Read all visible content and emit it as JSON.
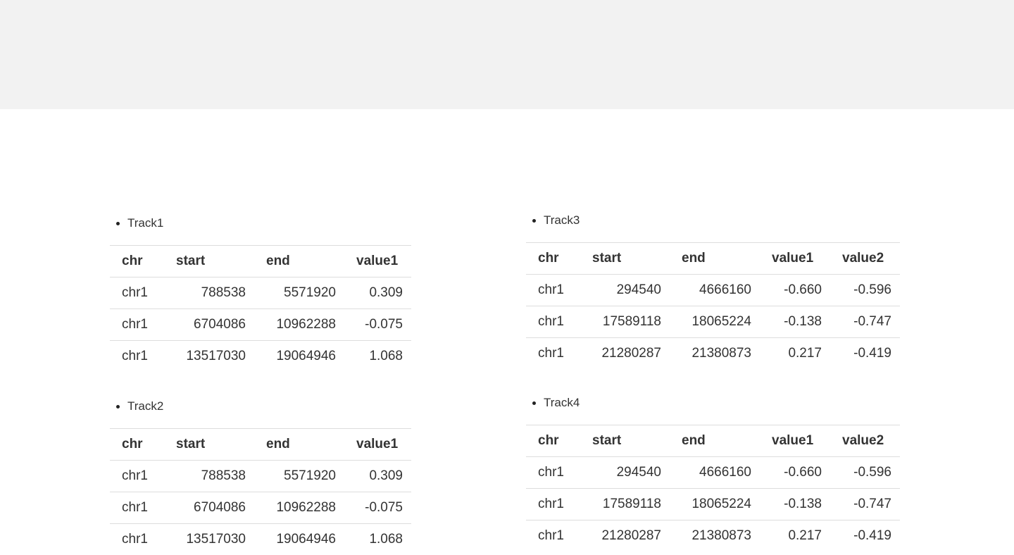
{
  "tracks": [
    {
      "label": "Track1",
      "columns": [
        "chr",
        "start",
        "end",
        "value1"
      ],
      "rows": [
        [
          "chr1",
          "788538",
          "5571920",
          "0.309"
        ],
        [
          "chr1",
          "6704086",
          "10962288",
          "-0.075"
        ],
        [
          "chr1",
          "13517030",
          "19064946",
          "1.068"
        ]
      ]
    },
    {
      "label": "Track2",
      "columns": [
        "chr",
        "start",
        "end",
        "value1"
      ],
      "rows": [
        [
          "chr1",
          "788538",
          "5571920",
          "0.309"
        ],
        [
          "chr1",
          "6704086",
          "10962288",
          "-0.075"
        ],
        [
          "chr1",
          "13517030",
          "19064946",
          "1.068"
        ]
      ]
    },
    {
      "label": "Track3",
      "columns": [
        "chr",
        "start",
        "end",
        "value1",
        "value2"
      ],
      "rows": [
        [
          "chr1",
          "294540",
          "4666160",
          "-0.660",
          "-0.596"
        ],
        [
          "chr1",
          "17589118",
          "18065224",
          "-0.138",
          "-0.747"
        ],
        [
          "chr1",
          "21280287",
          "21380873",
          "0.217",
          "-0.419"
        ]
      ]
    },
    {
      "label": "Track4",
      "columns": [
        "chr",
        "start",
        "end",
        "value1",
        "value2"
      ],
      "rows": [
        [
          "chr1",
          "294540",
          "4666160",
          "-0.660",
          "-0.596"
        ],
        [
          "chr1",
          "17589118",
          "18065224",
          "-0.138",
          "-0.747"
        ],
        [
          "chr1",
          "21280287",
          "21380873",
          "0.217",
          "-0.419"
        ]
      ]
    }
  ]
}
